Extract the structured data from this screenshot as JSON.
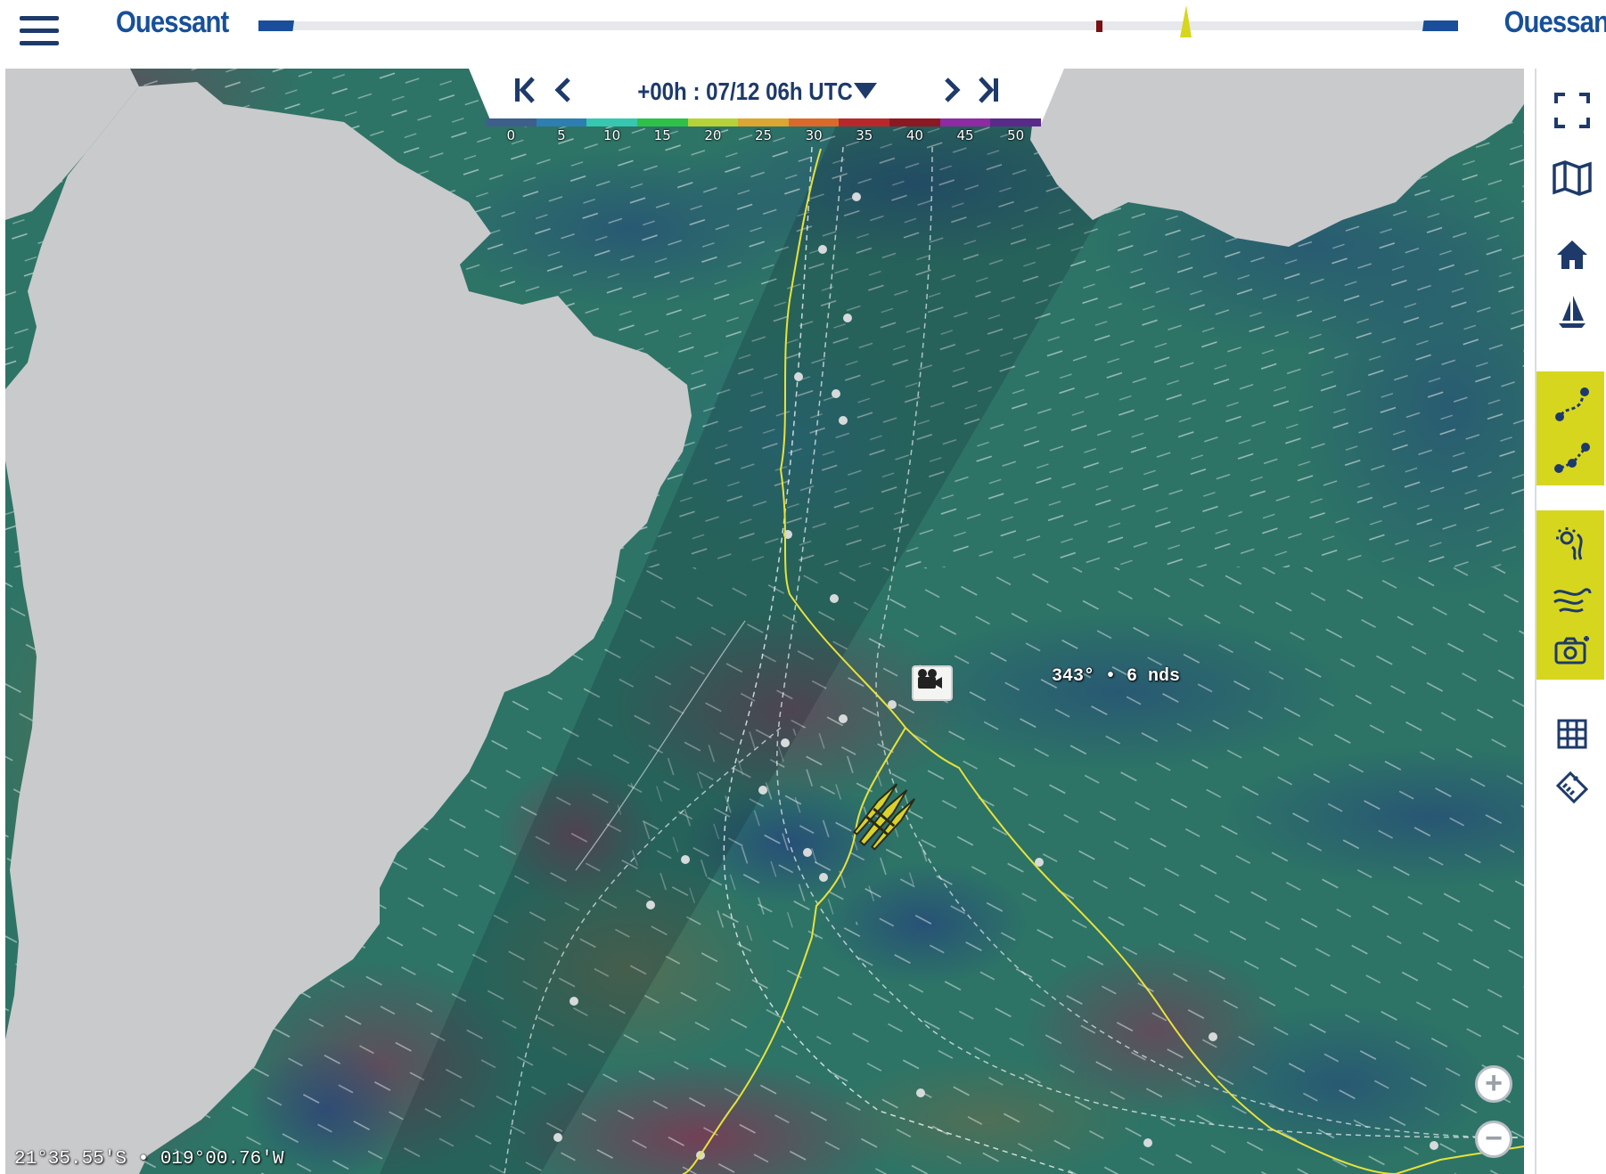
{
  "header": {
    "start_label": "Ouessant",
    "end_label": "Ouessant",
    "progress_fraction": 0.79,
    "accent_color": "#17509a"
  },
  "time_control": {
    "first_icon": "skip-first-icon",
    "prev_icon": "chevron-left-icon",
    "label": "+00h : 07/12 06h UTC",
    "dropdown_icon": "caret-down-icon",
    "next_icon": "chevron-right-icon",
    "last_icon": "skip-last-icon"
  },
  "wind_scale": {
    "labels": [
      "0",
      "5",
      "10",
      "15",
      "20",
      "25",
      "30",
      "35",
      "40",
      "45",
      "50"
    ],
    "colors": [
      "#3e5e8c",
      "#2c7fb0",
      "#36c7b0",
      "#2fc04a",
      "#b6d236",
      "#dba632",
      "#db6a2a",
      "#b8282a",
      "#8c1822",
      "#8e2aa2",
      "#5a2a8a"
    ]
  },
  "map": {
    "wind_readout": "343° • 6 nds",
    "coordinates": "21°35.55'S • 019°00.76'W",
    "camera_icon": "camera-icon",
    "boat_icon": "trimaran-icon",
    "route_color": "#e8e23a"
  },
  "zoom": {
    "in_label": "+",
    "out_label": "−"
  },
  "toolbar": {
    "items": [
      {
        "icon": "fullscreen-icon",
        "active": false
      },
      {
        "icon": "map-icon",
        "active": false
      },
      {
        "icon": "home-icon",
        "active": false
      },
      {
        "icon": "sailboat-icon",
        "active": false
      },
      {
        "icon": "route-curve-icon",
        "active": true
      },
      {
        "icon": "route-points-icon",
        "active": true
      },
      {
        "icon": "weather-icon",
        "active": true
      },
      {
        "icon": "wind-icon",
        "active": true
      },
      {
        "icon": "camera-add-icon",
        "active": true
      },
      {
        "icon": "grid-icon",
        "active": false
      },
      {
        "icon": "ruler-icon",
        "active": false
      }
    ],
    "active_color": "#d7d61e"
  }
}
